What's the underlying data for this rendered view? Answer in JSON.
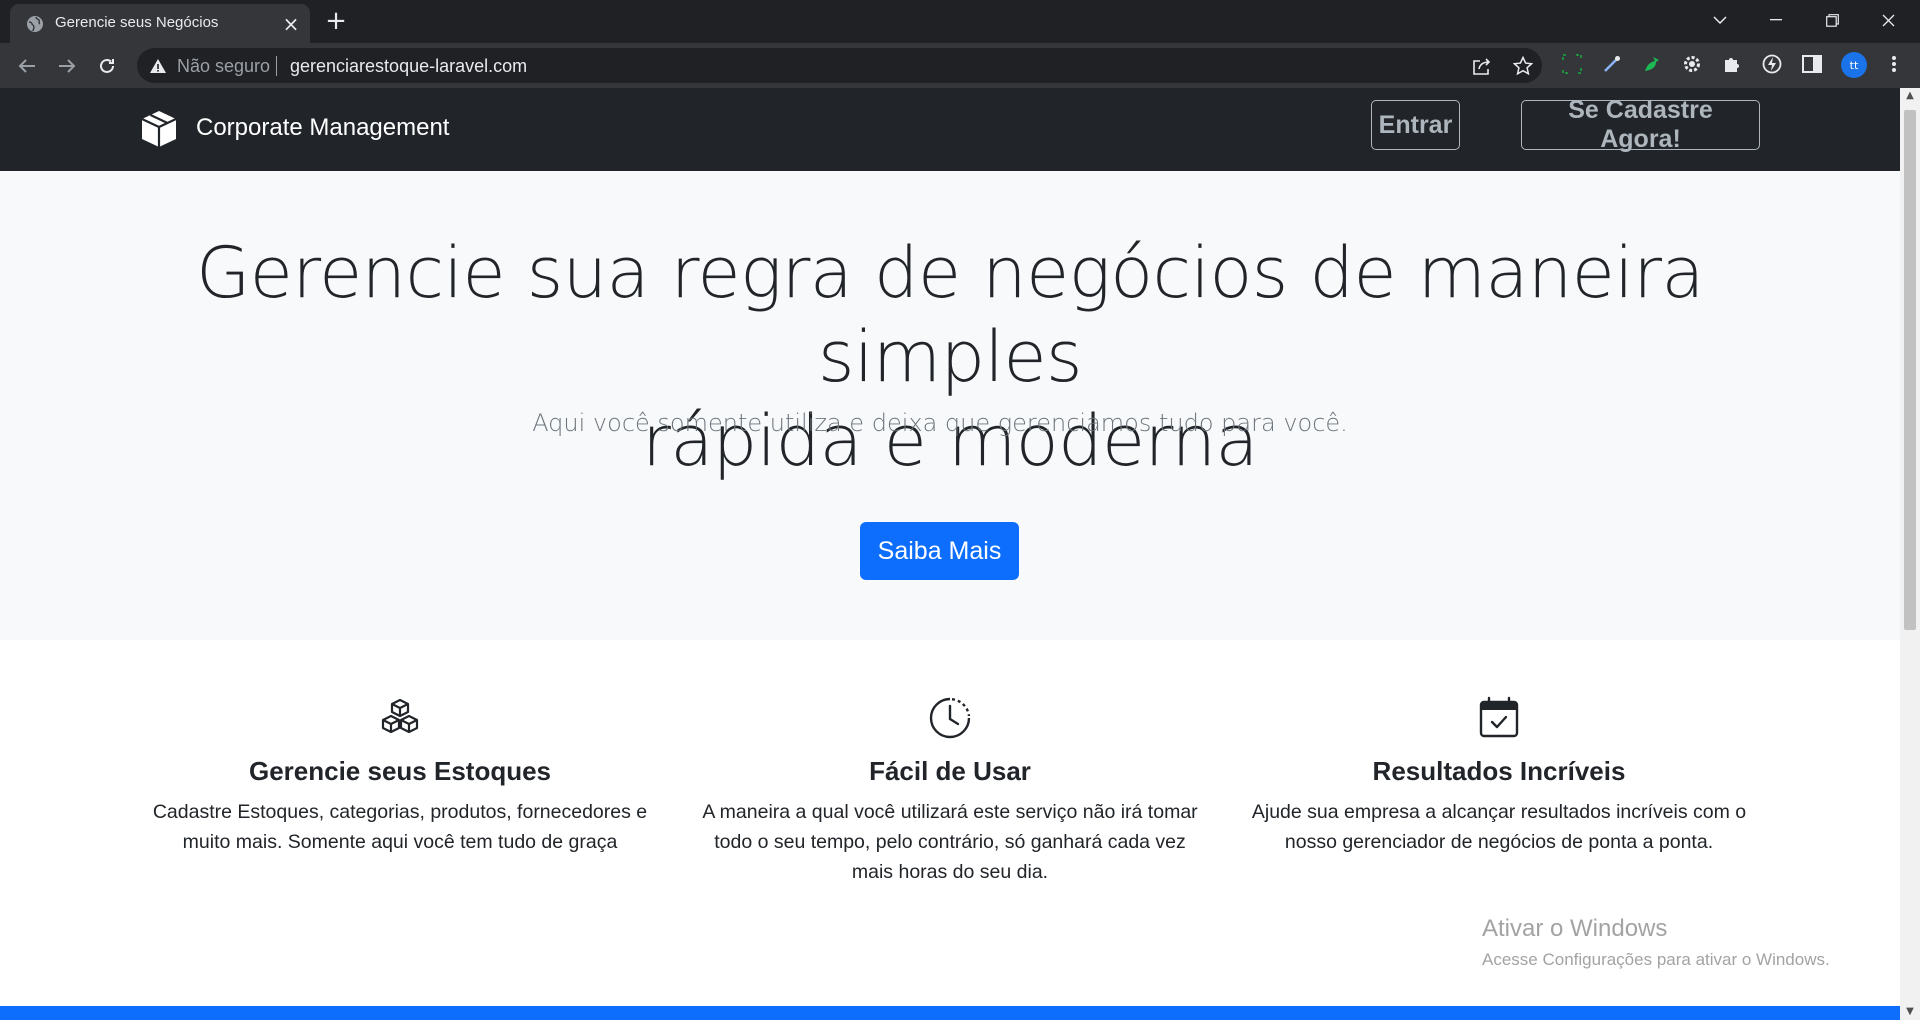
{
  "browser": {
    "tab_title": "Gerencie seus Negócios",
    "security_label": "Não seguro",
    "url": "gerenciarestoque-laravel.com",
    "profile_initials": "tt"
  },
  "navbar": {
    "brand": "Corporate Management",
    "login_label": "Entrar",
    "signup_label": "Se Cadastre Agora!"
  },
  "hero": {
    "title_line1": "Gerencie sua regra de negócios de maneira simples",
    "title_line2": "rápida e moderna",
    "subtitle": "Aqui você somente utiliza e deixa que gerenciamos tudo para você.",
    "cta_label": "Saiba Mais"
  },
  "features": [
    {
      "icon": "boxes-icon",
      "title": "Gerencie seus Estoques",
      "text": "Cadastre Estoques, categorias, produtos, fornecedores e muito mais. Somente aqui você tem tudo de graça"
    },
    {
      "icon": "clock-icon",
      "title": "Fácil de Usar",
      "text": "A maneira a qual você utilizará este serviço não irá tomar todo o seu tempo, pelo contrário, só ganhará cada vez mais horas do seu dia."
    },
    {
      "icon": "calendar-check-icon",
      "title": "Resultados Incríveis",
      "text": "Ajude sua empresa a alcançar resultados incríveis com o nosso gerenciador de negócios de ponta a ponta."
    }
  ],
  "watermark": {
    "title": "Ativar o Windows",
    "subtitle": "Acesse Configurações para ativar o Windows."
  },
  "colors": {
    "navbar_bg": "#212529",
    "hero_bg": "#f8f9fa",
    "primary": "#0d6efd"
  }
}
